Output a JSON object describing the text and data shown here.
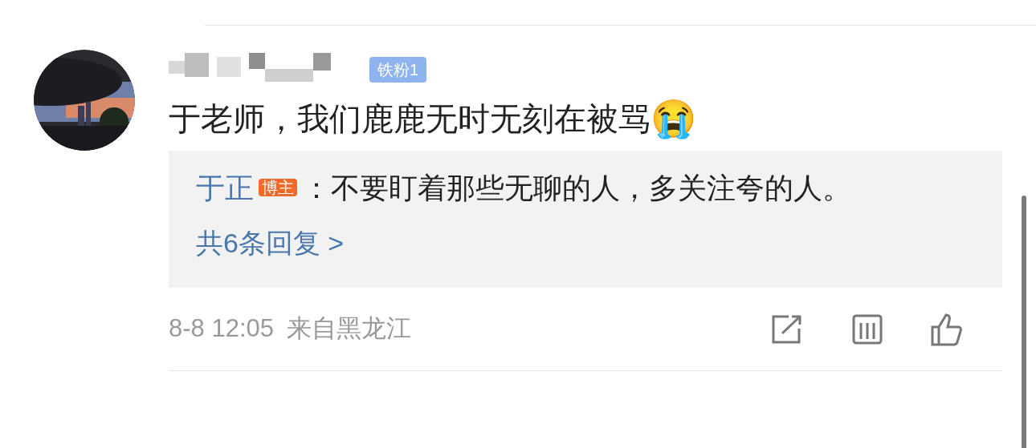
{
  "comment": {
    "badge": "铁粉1",
    "text": "于老师，我们鹿鹿无时无刻在被骂",
    "emoji": "😭"
  },
  "reply_box": {
    "author": "于正",
    "author_badge": "博主",
    "text": "：不要盯着那些无聊的人，多关注夸的人。",
    "more": "共6条回复 >"
  },
  "footer": {
    "time": "8-8 12:05",
    "location": "来自黑龙江"
  }
}
